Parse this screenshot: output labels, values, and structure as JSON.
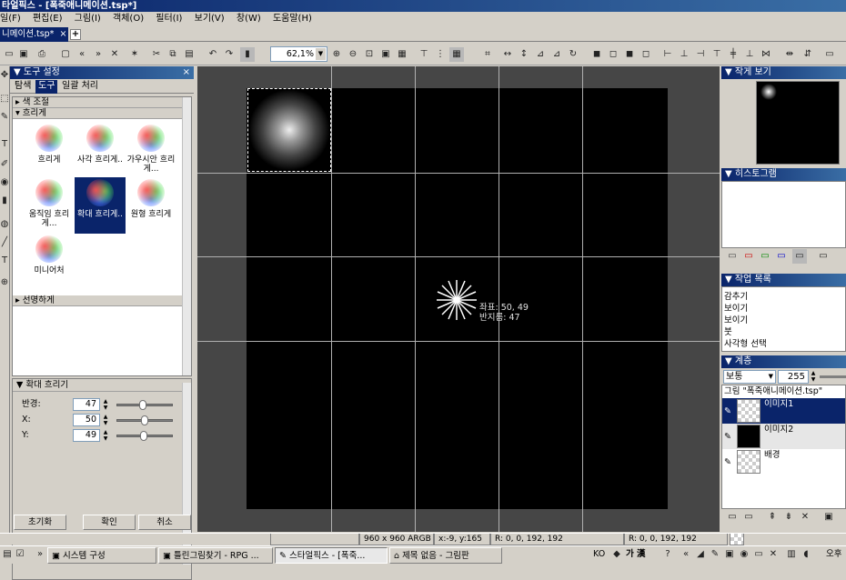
{
  "window": {
    "title": "타얼픽스 - [폭죽애니메이션.tsp*]"
  },
  "menu": [
    "일(F)",
    "편집(E)",
    "그림(I)",
    "객체(O)",
    "필터(I)",
    "보기(V)",
    "창(W)",
    "도움말(H)"
  ],
  "doc_tab": {
    "label": "니메이션.tsp*",
    "close": "×",
    "new": "+"
  },
  "toolbar": {
    "zoom": "62,1%"
  },
  "tool_panel": {
    "title": "도구 설정",
    "close": "×",
    "tabs": [
      "탐색",
      "도구",
      "일괄 처리"
    ],
    "active_tab": "도구",
    "groups": {
      "color_adjust": "색 조절",
      "blur": "흐리게",
      "sharpen": "선명하게"
    },
    "effects": [
      {
        "label": "흐리게"
      },
      {
        "label": "사각 흐리게.."
      },
      {
        "label": "가우시안 흐리게..."
      },
      {
        "label": "움직임 흐리게..."
      },
      {
        "label": "확대 흐리게.."
      },
      {
        "label": "원형 흐리게"
      },
      {
        "label": "미니어처"
      }
    ],
    "properties_title": "확대 흐리기",
    "properties": [
      {
        "label": "반경:",
        "value": "47",
        "fraction": 0.47
      },
      {
        "label": "X:",
        "value": "50",
        "fraction": 0.5
      },
      {
        "label": "Y:",
        "value": "49",
        "fraction": 0.49
      }
    ],
    "buttons": {
      "reset": "초기화",
      "ok": "확인",
      "cancel": "취소"
    }
  },
  "canvas": {
    "cursor_info": [
      "좌표: 50, 49",
      "반지름: 47"
    ]
  },
  "right_panel": {
    "preview_title": "작게 보기",
    "histogram_title": "히스토그램",
    "history_title": "작업 목록",
    "history_items": [
      "감추기",
      "보이기",
      "보이기",
      "붓",
      "사각형 선택"
    ],
    "layers_title": "계층",
    "blend_mode": "보통",
    "opacity": "255",
    "image_label": "그림 \"폭죽애니메이션.tsp\"",
    "layers": [
      {
        "name": "이미지1",
        "selected": true
      },
      {
        "name": "이미지2",
        "selected": false
      },
      {
        "name": "배경",
        "selected": false
      }
    ]
  },
  "status": {
    "size": "960 x 960 ARGB",
    "coords": "x:-9, y:165",
    "color1": "R: 0, 0, 192, 192",
    "color2": "R: 0, 0, 192, 192"
  },
  "taskbar": {
    "tasks": [
      {
        "label": "시스템 구성",
        "active": false
      },
      {
        "label": "틀린그림찾기 - RPG ...",
        "active": false
      },
      {
        "label": "스타얼픽스 - [폭죽...",
        "active": true
      },
      {
        "label": "제목 없음 - 그림판",
        "active": false
      }
    ],
    "ime": "KO",
    "ime_chars": "가 漢",
    "clock": "오후"
  }
}
